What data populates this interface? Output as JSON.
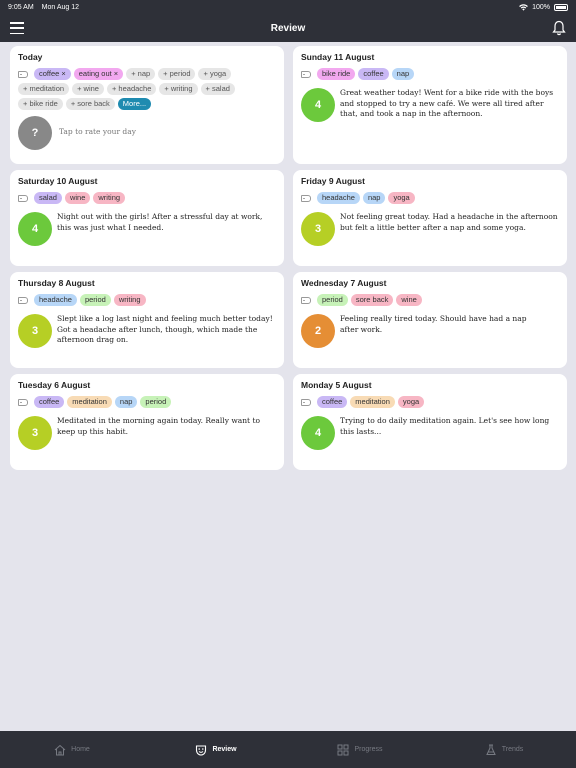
{
  "status": {
    "time": "9:05 AM",
    "date": "Mon Aug 12",
    "battery": "100%"
  },
  "header": {
    "title": "Review"
  },
  "today": {
    "title": "Today",
    "selected_tags": [
      "coffee ×",
      "eating out ×"
    ],
    "add_tags": [
      "+ nap",
      "+ period",
      "+ yoga",
      "+ meditation",
      "+ wine",
      "+ headache",
      "+ writing",
      "+ salad",
      "+ bike ride",
      "+ sore back"
    ],
    "more_label": "More...",
    "rating": "?",
    "prompt": "Tap to rate your day"
  },
  "entries": [
    {
      "date": "Sunday 11 August",
      "tags": [
        "bike ride",
        "coffee",
        "nap"
      ],
      "rating": "4",
      "text": "Great weather today! Went for a bike ride with the boys and stopped to try a new café. We were all tired after that, and took a nap in the afternoon."
    },
    {
      "date": "Saturday 10 August",
      "tags": [
        "salad",
        "wine",
        "writing"
      ],
      "rating": "4",
      "text": "Night out with the girls! After a stressful day at work, this was just what I needed."
    },
    {
      "date": "Friday 9 August",
      "tags": [
        "headache",
        "nap",
        "yoga"
      ],
      "rating": "3",
      "text": "Not feeling great today. Had a headache in the afternoon but felt a little better after a nap and some yoga."
    },
    {
      "date": "Thursday 8 August",
      "tags": [
        "headache",
        "period",
        "writing"
      ],
      "rating": "3",
      "text": "Slept like a log last night and feeling much better today! Got a headache after lunch, though, which made the afternoon drag on."
    },
    {
      "date": "Wednesday 7 August",
      "tags": [
        "period",
        "sore back",
        "wine"
      ],
      "rating": "2",
      "text": "Feeling really tired today. Should have had a nap after work."
    },
    {
      "date": "Tuesday 6 August",
      "tags": [
        "coffee",
        "meditation",
        "nap",
        "period"
      ],
      "rating": "3",
      "text": "Meditated in the morning again today. Really want to keep up this habit."
    },
    {
      "date": "Monday 5 August",
      "tags": [
        "coffee",
        "meditation",
        "yoga"
      ],
      "rating": "4",
      "text": "Trying to do daily meditation again. Let's see how long this lasts..."
    }
  ],
  "tabs": [
    {
      "label": "Home",
      "icon": "home-icon",
      "active": false
    },
    {
      "label": "Review",
      "icon": "review-mask-icon",
      "active": true
    },
    {
      "label": "Progress",
      "icon": "progress-grid-icon",
      "active": false
    },
    {
      "label": "Trends",
      "icon": "trends-icon",
      "active": false
    }
  ]
}
